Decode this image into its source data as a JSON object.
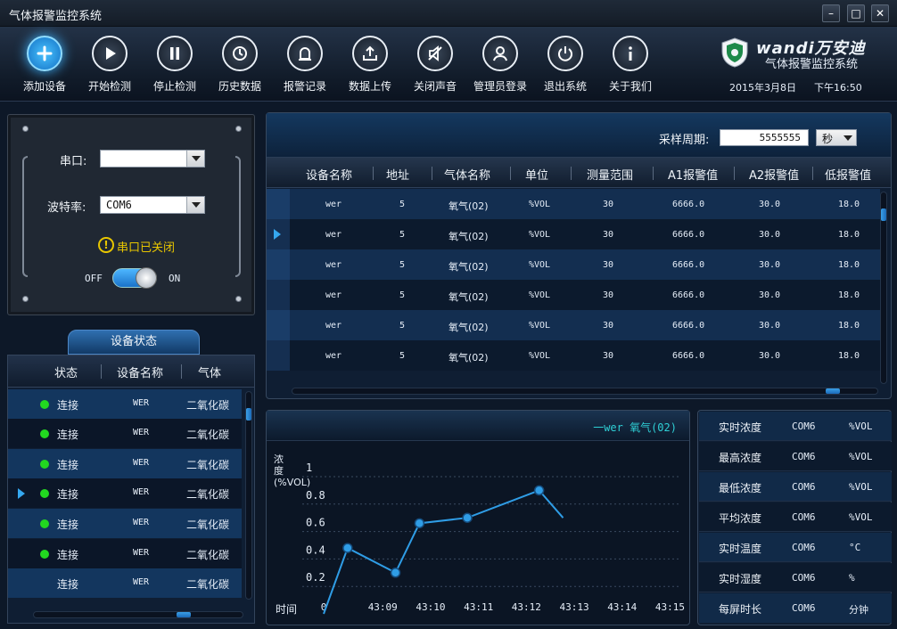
{
  "window": {
    "title": "气体报警监控系统",
    "min": "–",
    "max": "□",
    "close": "✕"
  },
  "toolbar": {
    "items": [
      {
        "label": "添加设备",
        "icon": "plus-icon"
      },
      {
        "label": "开始检测",
        "icon": "play-icon"
      },
      {
        "label": "停止检测",
        "icon": "pause-icon"
      },
      {
        "label": "历史数据",
        "icon": "history-icon"
      },
      {
        "label": "报警记录",
        "icon": "alarm-icon"
      },
      {
        "label": "数据上传",
        "icon": "upload-icon"
      },
      {
        "label": "关闭声音",
        "icon": "mute-icon"
      },
      {
        "label": "管理员登录",
        "icon": "user-icon"
      },
      {
        "label": "退出系统",
        "icon": "power-icon"
      },
      {
        "label": "关于我们",
        "icon": "info-icon"
      }
    ],
    "brand": "wandi万安迪",
    "subtitle": "气体报警监控系统",
    "date": "2015年3月8日",
    "time": "下午16:50"
  },
  "port": {
    "port_label": "串口:",
    "port_value": "",
    "baud_label": "波特率:",
    "baud_value": "COM6",
    "status": "串口已关闭",
    "off": "OFF",
    "on": "ON"
  },
  "device_status": {
    "tab": "设备状态",
    "headers": [
      "状态",
      "设备名称",
      "气体"
    ],
    "rows": [
      {
        "status": "连接",
        "name": "WER",
        "gas": "二氧化碳",
        "online": true
      },
      {
        "status": "连接",
        "name": "WER",
        "gas": "二氧化碳",
        "online": true
      },
      {
        "status": "连接",
        "name": "WER",
        "gas": "二氧化碳",
        "online": true
      },
      {
        "status": "连接",
        "name": "WER",
        "gas": "二氧化碳",
        "online": true
      },
      {
        "status": "连接",
        "name": "WER",
        "gas": "二氧化碳",
        "online": true
      },
      {
        "status": "连接",
        "name": "WER",
        "gas": "二氧化碳",
        "online": true
      },
      {
        "status": "连接",
        "name": "WER",
        "gas": "二氧化碳",
        "online": false
      }
    ]
  },
  "data_table": {
    "period_label": "采样周期:",
    "period_value": "5555555",
    "period_unit": "秒",
    "headers": [
      "设备名称",
      "地址",
      "气体名称",
      "单位",
      "测量范围",
      "A1报警值",
      "A2报警值",
      "低报警值"
    ],
    "rows": [
      [
        "wer",
        "5",
        "氧气(02)",
        "%VOL",
        "30",
        "6666.0",
        "30.0",
        "18.0"
      ],
      [
        "wer",
        "5",
        "氧气(02)",
        "%VOL",
        "30",
        "6666.0",
        "30.0",
        "18.0"
      ],
      [
        "wer",
        "5",
        "氧气(02)",
        "%VOL",
        "30",
        "6666.0",
        "30.0",
        "18.0"
      ],
      [
        "wer",
        "5",
        "氧气(02)",
        "%VOL",
        "30",
        "6666.0",
        "30.0",
        "18.0"
      ],
      [
        "wer",
        "5",
        "氧气(02)",
        "%VOL",
        "30",
        "6666.0",
        "30.0",
        "18.0"
      ],
      [
        "wer",
        "5",
        "氧气(02)",
        "%VOL",
        "30",
        "6666.0",
        "30.0",
        "18.0"
      ]
    ]
  },
  "chart_data": {
    "type": "line",
    "ylabel": "浓度(%VOL)",
    "xlabel": "时间",
    "legend": "一wer 氧气(02)",
    "x": [
      "0",
      "43:09",
      "43:10",
      "43:11",
      "43:12",
      "43:13",
      "43:14",
      "43:15"
    ],
    "y_ticks": [
      "0.2",
      "0.4",
      "0.6",
      "0.8",
      "1"
    ],
    "ylim": [
      0,
      1
    ],
    "grid": true,
    "series": [
      {
        "name": "wer 氧气(02)",
        "color": "#2f9de6",
        "points": [
          [
            0,
            0
          ],
          [
            0.5,
            0.48
          ],
          [
            1.5,
            0.3
          ],
          [
            2,
            0.66
          ],
          [
            3,
            0.7
          ],
          [
            4.5,
            0.9
          ],
          [
            5,
            0.7
          ]
        ]
      }
    ]
  },
  "realtime": {
    "rows": [
      {
        "label": "实时浓度",
        "value": "COM6",
        "unit": "%VOL"
      },
      {
        "label": "最高浓度",
        "value": "COM6",
        "unit": "%VOL"
      },
      {
        "label": "最低浓度",
        "value": "COM6",
        "unit": "%VOL"
      },
      {
        "label": "平均浓度",
        "value": "COM6",
        "unit": "%VOL"
      },
      {
        "label": "实时温度",
        "value": "COM6",
        "unit": "°C"
      },
      {
        "label": "实时湿度",
        "value": "COM6",
        "unit": "%"
      },
      {
        "label": "每屏时长",
        "value": "COM6",
        "unit": "分钟"
      }
    ]
  }
}
